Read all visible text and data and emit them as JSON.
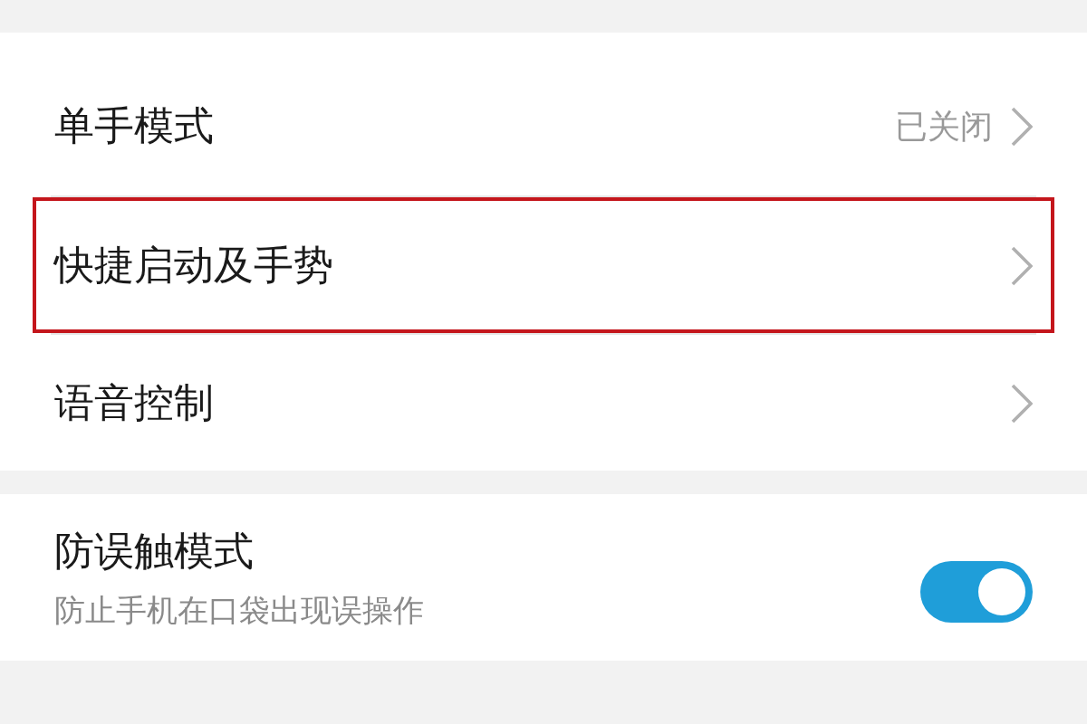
{
  "groups": [
    {
      "items": [
        {
          "kind": "link",
          "label": "单手模式",
          "value": "已关闭",
          "highlighted": false
        },
        {
          "kind": "link",
          "label": "快捷启动及手势",
          "highlighted": true
        },
        {
          "kind": "link",
          "label": "语音控制",
          "highlighted": false
        }
      ]
    },
    {
      "items": [
        {
          "kind": "switch",
          "label": "防误触模式",
          "description": "防止手机在口袋出现误操作",
          "on": true,
          "highlighted": false
        }
      ]
    }
  ]
}
